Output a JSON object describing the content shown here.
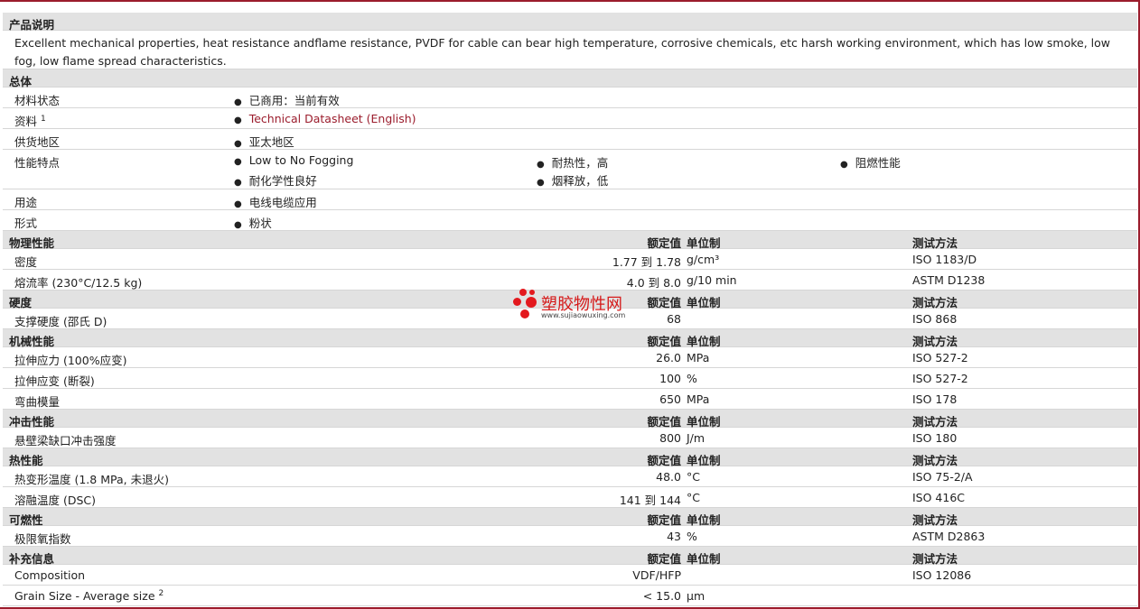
{
  "product_description": {
    "title": "产品说明",
    "text": "Excellent mechanical properties, heat resistance andflame resistance, PVDF for cable can bear high temperature, corrosive chemicals, etc harsh working environment, which has low smoke, low fog, low flame spread characteristics."
  },
  "general": {
    "title": "总体",
    "rows": [
      {
        "label": "材料状态",
        "values": [
          "已商用：当前有效"
        ]
      },
      {
        "label": "资料",
        "sup": "1",
        "values": [
          "Technical Datasheet (English)"
        ]
      },
      {
        "label": "供货地区",
        "values": [
          "亚太地区"
        ]
      },
      {
        "label": "性能特点",
        "values": [
          "Low to No Fogging",
          "耐热性，高",
          "阻燃性能",
          "耐化学性良好",
          "烟释放，低"
        ]
      },
      {
        "label": "用途",
        "values": [
          "电线电缆应用"
        ]
      },
      {
        "label": "形式",
        "values": [
          "粉状"
        ]
      }
    ]
  },
  "headers": {
    "rated": "额定值",
    "unit": "单位制",
    "method": "测试方法"
  },
  "sections": [
    {
      "title": "物理性能",
      "rows": [
        {
          "label": "密度",
          "value": "1.77 到  1.78",
          "unit": "g/cm³",
          "method": "ISO 1183/D"
        },
        {
          "label": "熔流率 (230°C/12.5 kg)",
          "value": "4.0 到  8.0",
          "unit": "g/10 min",
          "method": "ASTM D1238"
        }
      ]
    },
    {
      "title": "硬度",
      "rows": [
        {
          "label": "支撑硬度 (邵氏 D)",
          "value": "68",
          "unit": "",
          "method": "ISO 868"
        }
      ]
    },
    {
      "title": "机械性能",
      "rows": [
        {
          "label": "拉伸应力 (100%应变)",
          "value": "26.0",
          "unit": "MPa",
          "method": "ISO 527-2"
        },
        {
          "label": "拉伸应变 (断裂)",
          "value": "100",
          "unit": "%",
          "method": "ISO 527-2"
        },
        {
          "label": "弯曲模量",
          "value": "650",
          "unit": "MPa",
          "method": "ISO 178"
        }
      ]
    },
    {
      "title": "冲击性能",
      "rows": [
        {
          "label": "悬壁梁缺口冲击强度",
          "value": "800",
          "unit": "J/m",
          "method": "ISO 180"
        }
      ]
    },
    {
      "title": "热性能",
      "rows": [
        {
          "label": "热变形温度 (1.8 MPa, 未退火)",
          "value": "48.0",
          "unit": "°C",
          "method": "ISO 75-2/A"
        },
        {
          "label": "溶融温度 (DSC)",
          "value": "141 到  144",
          "unit": "°C",
          "method": "ISO 416C"
        }
      ]
    },
    {
      "title": "可燃性",
      "rows": [
        {
          "label": "极限氧指数",
          "value": "43",
          "unit": "%",
          "method": "ASTM D2863"
        }
      ]
    },
    {
      "title": "补充信息",
      "rows": [
        {
          "label": "Composition",
          "value": "VDF/HFP",
          "unit": "",
          "method": "ISO 12086"
        },
        {
          "label": "Grain Size - Average size",
          "sup": "2",
          "value": "< 15.0",
          "unit": "µm",
          "method": ""
        }
      ]
    }
  ],
  "watermark": {
    "name": "塑胶物性网",
    "url": "www.sujiaowuxing.com"
  }
}
